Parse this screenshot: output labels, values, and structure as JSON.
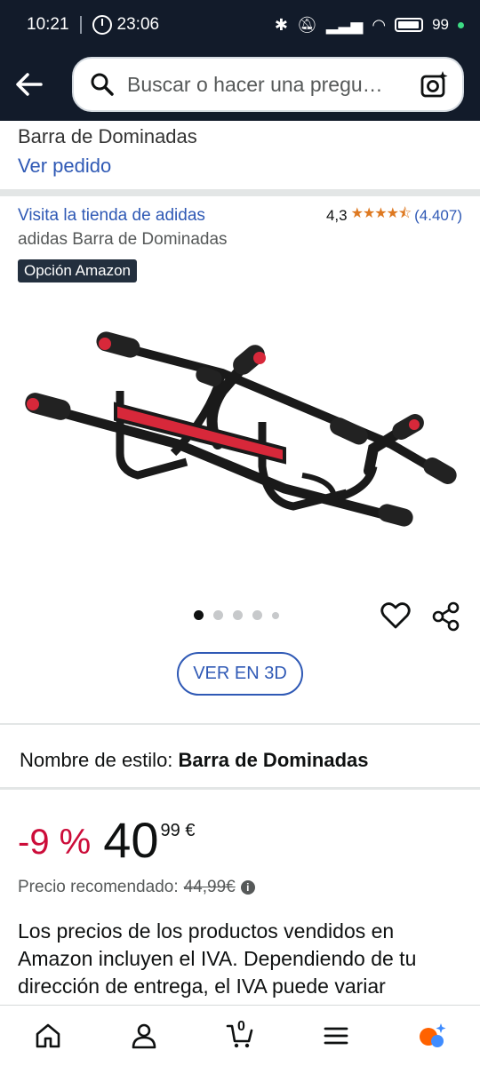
{
  "status": {
    "time": "10:21",
    "timer": "23:06",
    "battery": "99"
  },
  "search": {
    "placeholder": "Buscar o hacer una pregu…"
  },
  "order": {
    "title": "Barra de Dominadas",
    "link": "Ver pedido"
  },
  "product": {
    "store_link": "Visita la tienda de adidas",
    "rating_value": "4,3",
    "stars": "★★★★⯪",
    "rating_count": "(4.407)",
    "name": "adidas Barra de Dominadas",
    "badge": "Opción Amazon",
    "image_count": 5,
    "active_image": 1,
    "view_3d": "VER EN 3D"
  },
  "style": {
    "label": "Nombre de estilo:",
    "value": "Barra de Dominadas"
  },
  "price": {
    "discount": "-9 %",
    "whole": "40",
    "fraction": "99 €",
    "rrp_label": "Precio recomendado:",
    "rrp_value": "44,99€"
  },
  "vat_text": "Los precios de los productos vendidos en Amazon incluyen el IVA. Dependiendo de tu dirección de entrega, el IVA puede variar",
  "nav": {
    "cart_count": "0"
  },
  "colors": {
    "header": "#121b2a",
    "link": "#2f59b5",
    "discount": "#cc0c39",
    "stars": "#de7921",
    "accent_red": "#d7283a"
  }
}
